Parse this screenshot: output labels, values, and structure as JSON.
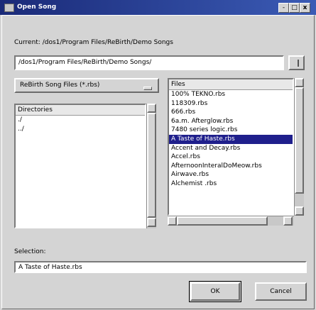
{
  "window": {
    "title": "Open Song"
  },
  "current_label": "Current: /dos1/Program Files/ReBirth/Demo Songs",
  "path_field": {
    "value": "/dos1/Program Files/ReBirth/Demo Songs/"
  },
  "filter": {
    "label": "ReBirth Song Files (*.rbs)"
  },
  "directories": {
    "header": "Directories",
    "items": [
      "./",
      "../"
    ]
  },
  "files": {
    "header": "Files",
    "items": [
      "100% TEKNO.rbs",
      "118309.rbs",
      "666.rbs",
      "6a.m. Afterglow.rbs",
      "7480 series logic.rbs",
      "A Taste of Haste.rbs",
      "Accent and Decay.rbs",
      "Accel.rbs",
      "AfternoonInteralDoMeow.rbs",
      "Airwave.rbs",
      "Alchemist .rbs"
    ],
    "selected_index": 5
  },
  "selection": {
    "label": "Selection:",
    "value": "A Taste of Haste.rbs"
  },
  "buttons": {
    "ok": "OK",
    "cancel": "Cancel"
  },
  "titlebar_buttons": {
    "minimize": "-",
    "maximize": "□",
    "close": "x"
  }
}
